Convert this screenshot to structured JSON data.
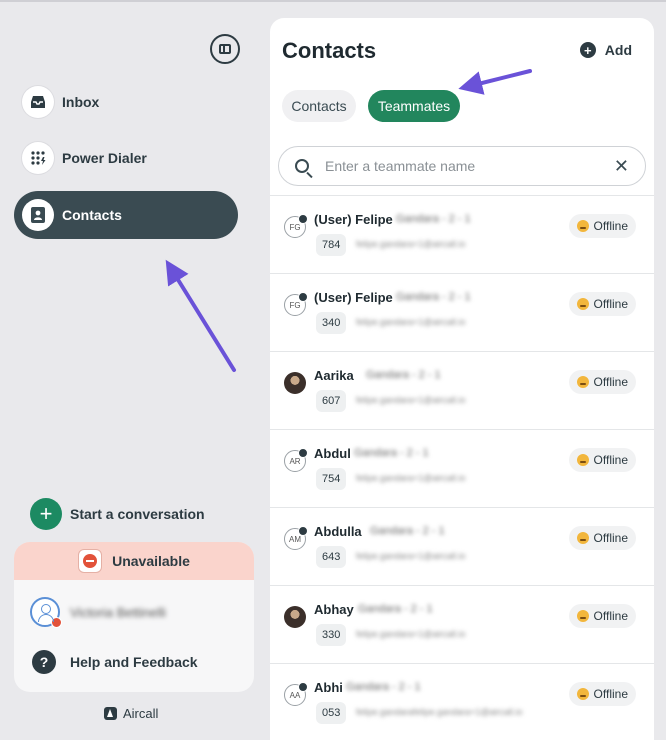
{
  "sidebar": {
    "nav": [
      {
        "id": "inbox",
        "label": "Inbox",
        "icon": "inbox-icon",
        "active": false
      },
      {
        "id": "power-dialer",
        "label": "Power Dialer",
        "icon": "keypad-icon",
        "active": false
      },
      {
        "id": "contacts",
        "label": "Contacts",
        "icon": "contact-book-icon",
        "active": true
      }
    ],
    "start_conversation_label": "Start a conversation",
    "status_label": "Unavailable",
    "user_name": "Victoria Bettinelli",
    "help_label": "Help and Feedback",
    "brand": "Aircall"
  },
  "panel": {
    "title": "Contacts",
    "add_label": "Add",
    "tabs": [
      {
        "label": "Contacts",
        "active": false
      },
      {
        "label": "Teammates",
        "active": true
      }
    ],
    "search_placeholder": "Enter a teammate name",
    "contacts": [
      {
        "initials": "FG",
        "name": "(User) Felipe",
        "name_rest": "Gandara - 2 - 1",
        "ext": "784",
        "email": "felipe.gandara+1@aircall.io",
        "status": "Offline",
        "photo": false
      },
      {
        "initials": "FG",
        "name": "(User) Felipe",
        "name_rest": "Gandara - 2 - 1",
        "ext": "340",
        "email": "felipe.gandara+1@aircall.io",
        "status": "Offline",
        "photo": false
      },
      {
        "initials": "",
        "name": "Aarika",
        "name_rest": "Gandara - 2 - 1",
        "ext": "607",
        "email": "felipe.gandara+1@aircall.io",
        "status": "Offline",
        "photo": true
      },
      {
        "initials": "AR",
        "name": "Abdul",
        "name_rest": "Gandara - 2 - 1",
        "ext": "754",
        "email": "felipe.gandara+1@aircall.io",
        "status": "Offline",
        "photo": false
      },
      {
        "initials": "AM",
        "name": "Abdulla",
        "name_rest": "Gandara - 2 - 1",
        "ext": "643",
        "email": "felipe.gandara+1@aircall.io",
        "status": "Offline",
        "photo": false
      },
      {
        "initials": "",
        "name": "Abhay",
        "name_rest": "Gandara - 2 - 1",
        "ext": "330",
        "email": "felipe.gandara+1@aircall.io",
        "status": "Offline",
        "photo": true
      },
      {
        "initials": "AA",
        "name": "Abhi",
        "name_rest": "Gandara - 2 - 1",
        "ext": "053",
        "email": "felipe.gandarafelipe.gandara+1@aircall.io",
        "status": "Offline",
        "photo": false
      }
    ]
  },
  "colors": {
    "accent_green": "#22865d",
    "nav_active": "#3a4b52",
    "unavailable_bg": "#fad4cc",
    "annotation_arrow": "#6a52d8"
  }
}
